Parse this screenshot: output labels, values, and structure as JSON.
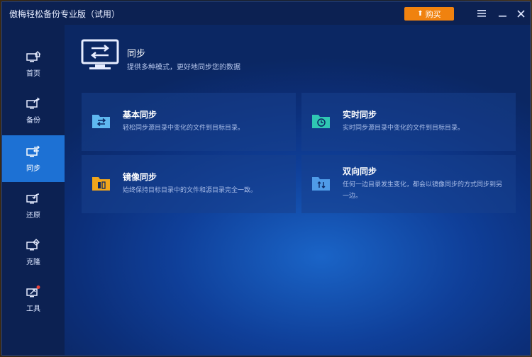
{
  "window": {
    "title": "傲梅轻松备份专业版（试用）",
    "buy_label": "购买"
  },
  "sidebar": {
    "items": [
      {
        "label": "首页",
        "icon": "home-icon"
      },
      {
        "label": "备份",
        "icon": "backup-icon"
      },
      {
        "label": "同步",
        "icon": "sync-icon",
        "active": true
      },
      {
        "label": "还原",
        "icon": "restore-icon"
      },
      {
        "label": "克隆",
        "icon": "clone-icon"
      },
      {
        "label": "工具",
        "icon": "tools-icon"
      }
    ]
  },
  "header": {
    "title": "同步",
    "subtitle": "提供多种模式，更好地同步您的数据"
  },
  "cards": [
    {
      "title": "基本同步",
      "desc": "轻松同步源目录中变化的文件到目标目录。",
      "icon": "basic-sync-folder-icon"
    },
    {
      "title": "实时同步",
      "desc": "实时同步源目录中变化的文件到目标目录。",
      "icon": "realtime-sync-folder-icon"
    },
    {
      "title": "镜像同步",
      "desc": "始终保持目标目录中的文件和源目录完全一致。",
      "icon": "mirror-sync-folder-icon"
    },
    {
      "title": "双向同步",
      "desc": "任何一边目录发生变化，都会以镜像同步的方式同步到另一边。",
      "icon": "two-way-sync-folder-icon"
    }
  ],
  "colors": {
    "accent": "#f0820f",
    "sidebar_active": "#1d71d4",
    "realtime_icon": "#2fc7b3",
    "mirror_icon": "#f0a61c",
    "basic_icon": "#5fb8f0",
    "twoway_icon": "#4f9be8"
  }
}
